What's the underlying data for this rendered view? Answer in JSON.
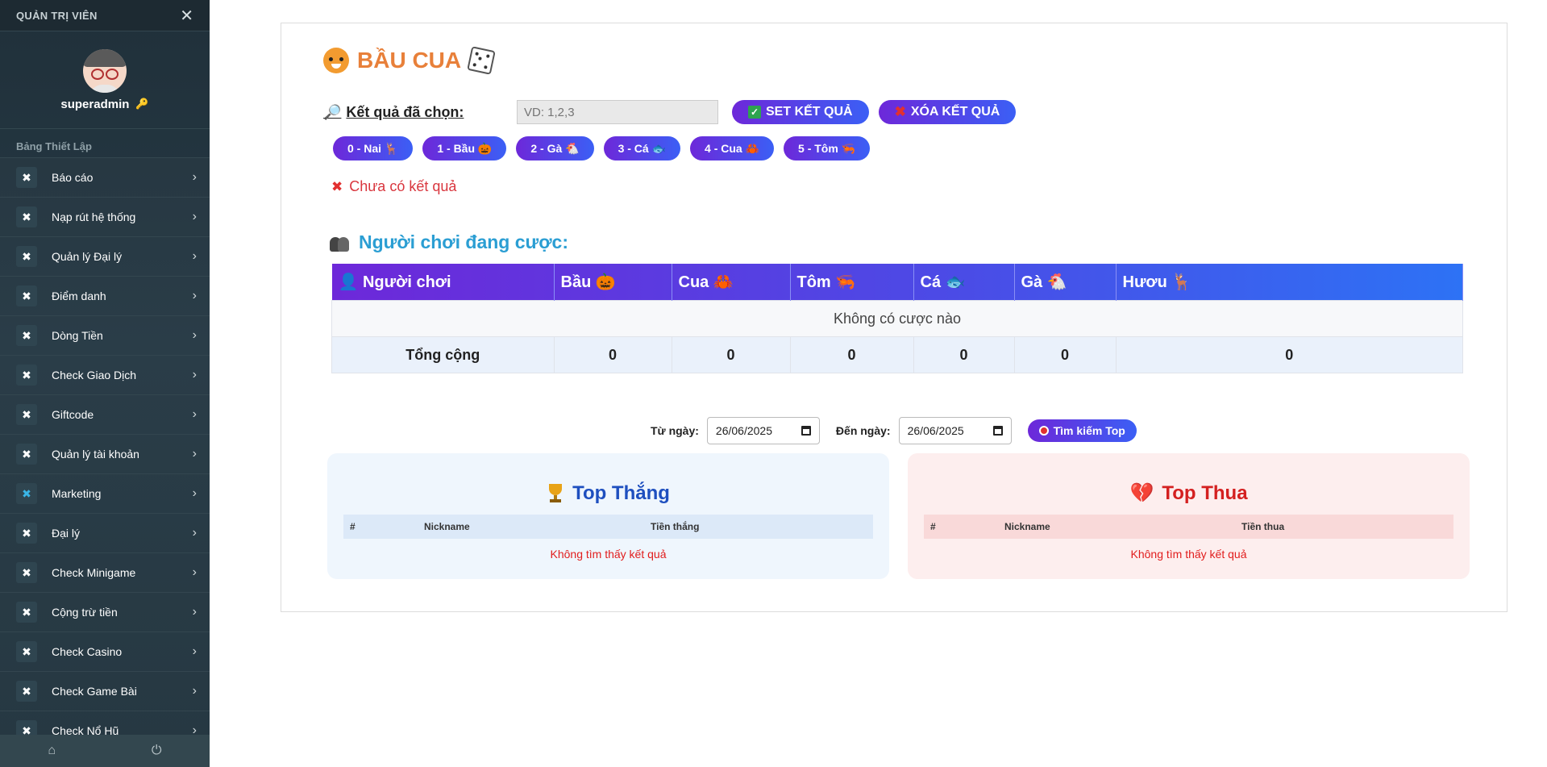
{
  "sidebar": {
    "title": "QUẢN TRỊ VIÊN",
    "username": "superadmin",
    "section": "Bảng Thiết Lập",
    "items": [
      {
        "label": "Báo cáo"
      },
      {
        "label": "Nạp rút hệ thống"
      },
      {
        "label": "Quản lý Đại lý"
      },
      {
        "label": "Điểm danh"
      },
      {
        "label": "Dòng Tiền"
      },
      {
        "label": "Check Giao Dịch"
      },
      {
        "label": "Giftcode"
      },
      {
        "label": "Quản lý tài khoản"
      },
      {
        "label": "Marketing"
      },
      {
        "label": "Đại lý"
      },
      {
        "label": "Check Minigame"
      },
      {
        "label": "Cộng trừ tiền"
      },
      {
        "label": "Check Casino"
      },
      {
        "label": "Check Game Bài"
      },
      {
        "label": "Check Nổ Hũ"
      }
    ]
  },
  "game": {
    "title": "BẦU CUA",
    "result_label": "Kết quả đã chọn:",
    "result_placeholder": "VD: 1,2,3",
    "set_button": "SET KẾT QUẢ",
    "clear_button": "XÓA KẾT QUẢ",
    "picks": [
      "0 - Nai 🦌",
      "1 - Bầu 🎃",
      "2 - Gà 🐔",
      "3 - Cá 🐟",
      "4 - Cua 🦀",
      "5 - Tôm 🦐"
    ],
    "no_result": "Chưa có kết quả"
  },
  "players": {
    "title": "Người chơi đang cược:",
    "headers": [
      "Người chơi",
      "Bầu 🎃",
      "Cua 🦀",
      "Tôm 🦐",
      "Cá 🐟",
      "Gà 🐔",
      "Hươu 🦌"
    ],
    "empty_text": "Không có cược nào",
    "total_label": "Tổng cộng",
    "totals": [
      "0",
      "0",
      "0",
      "0",
      "0",
      "0"
    ]
  },
  "filter": {
    "from_label": "Từ ngày:",
    "from_value": "26/06/2025",
    "to_label": "Đến ngày:",
    "to_value": "26/06/2025",
    "search_button": "Tìm kiếm Top"
  },
  "top_win": {
    "title": "Top Thắng",
    "headers": [
      "#",
      "Nickname",
      "Tiền thắng"
    ],
    "empty": "Không tìm thấy kết quả"
  },
  "top_lose": {
    "title": "Top Thua",
    "headers": [
      "#",
      "Nickname",
      "Tiền thua"
    ],
    "empty": "Không tìm thấy kết quả"
  },
  "colors": {
    "accent_purple": "#6d28d9",
    "accent_blue": "#3b5ff5",
    "title_orange": "#e8803a",
    "error_red": "#d9363e"
  }
}
